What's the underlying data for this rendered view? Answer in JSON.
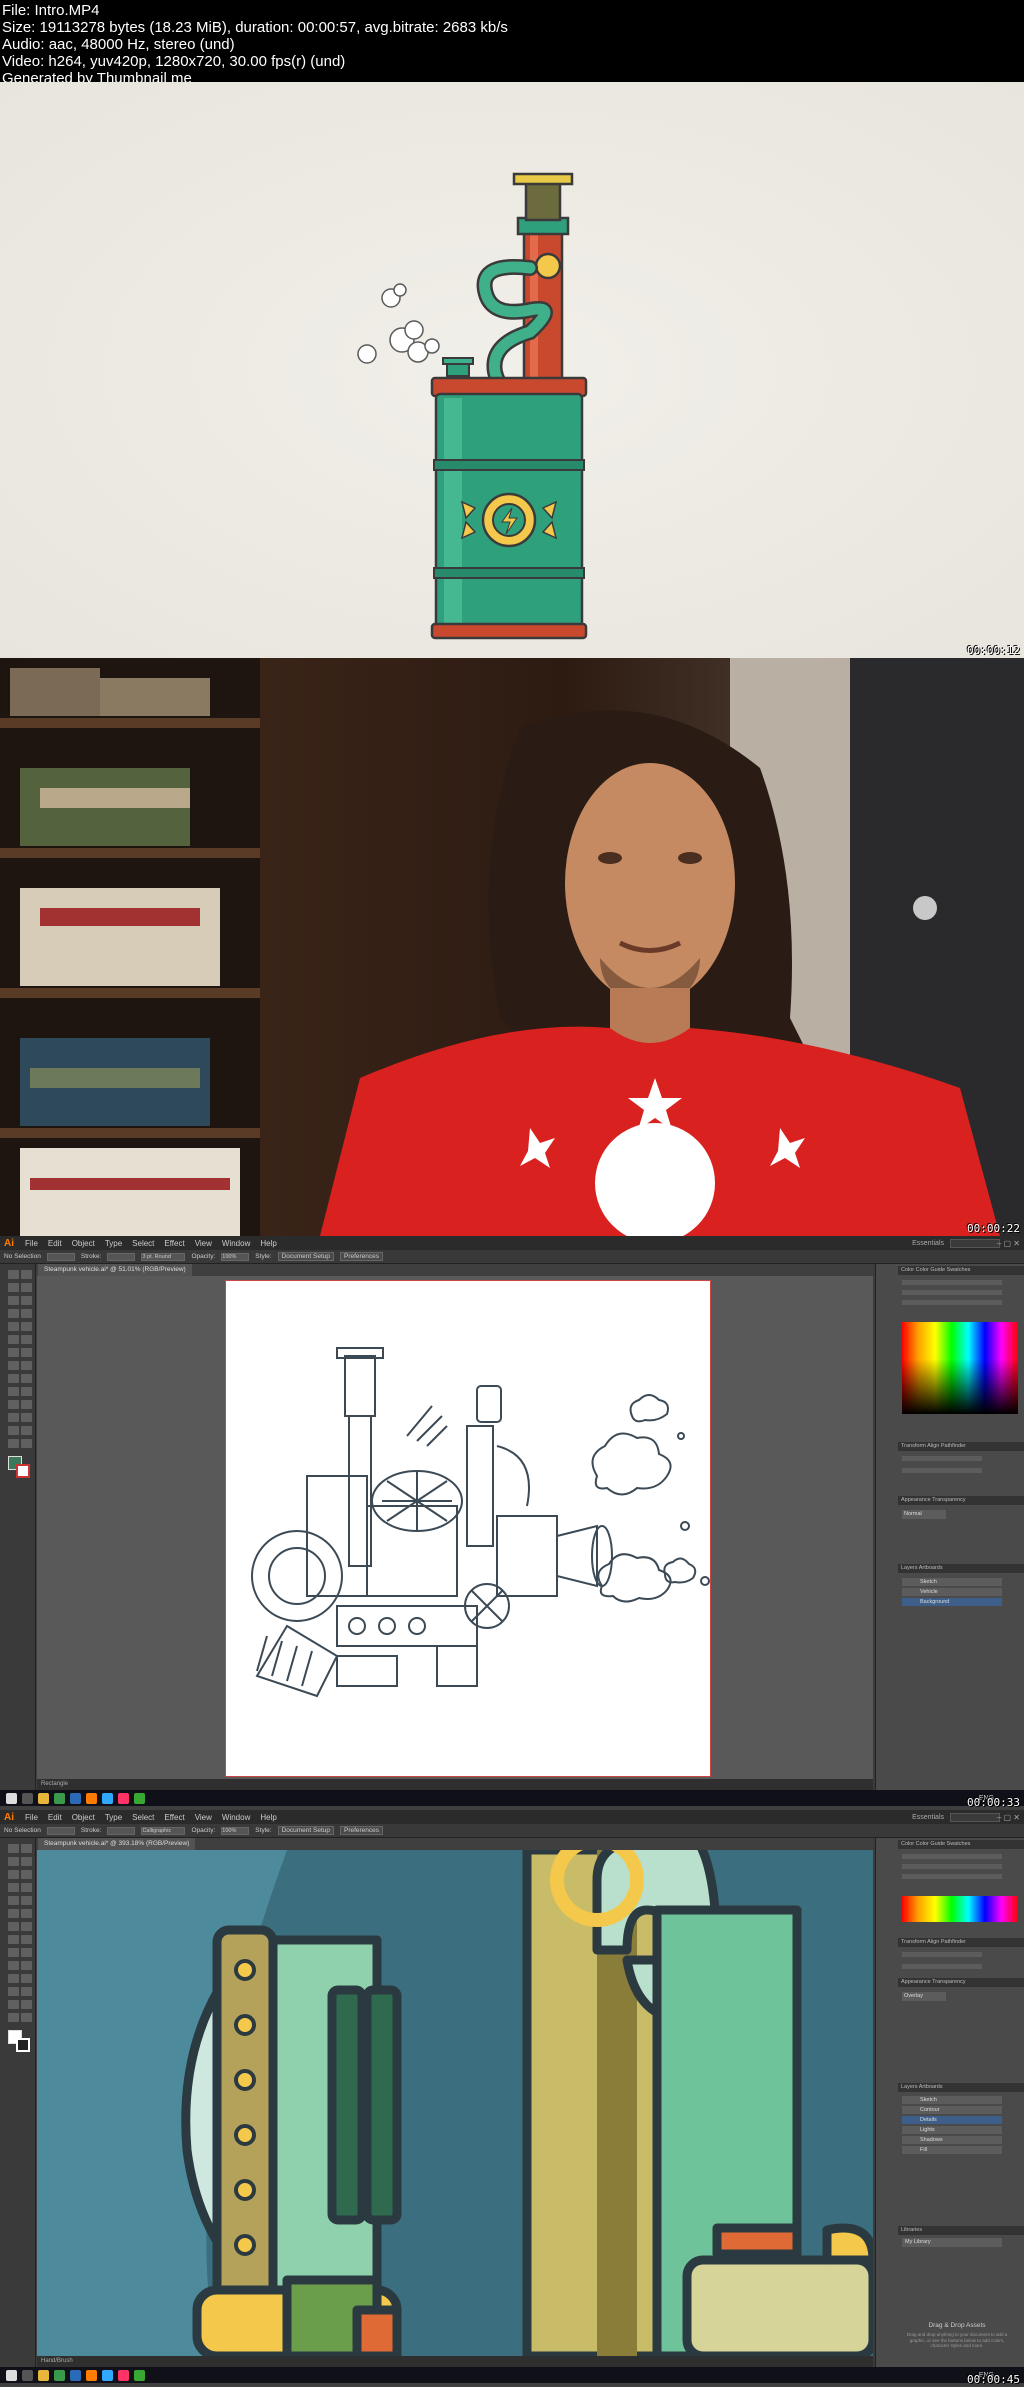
{
  "header": {
    "file": "File: Intro.MP4",
    "size": "Size: 19113278 bytes (18.23 MiB), duration: 00:00:57, avg.bitrate: 2683 kb/s",
    "audio": "Audio: aac, 48000 Hz, stereo (und)",
    "video": "Video: h264, yuv420p, 1280x720, 30.00 fps(r) (und)",
    "generator": "Generated by Thumbnail me"
  },
  "frames": [
    {
      "timestamp": "00:00:12"
    },
    {
      "timestamp": "00:00:22"
    },
    {
      "timestamp": "00:00:33"
    },
    {
      "timestamp": "00:00:45"
    }
  ],
  "illustrator": {
    "logo": "Ai",
    "menu": [
      "File",
      "Edit",
      "Object",
      "Type",
      "Select",
      "Effect",
      "View",
      "Window",
      "Help"
    ],
    "workspace": "Essentials",
    "control": {
      "selection": "No Selection",
      "stroke_label": "Stroke:",
      "opacity_label": "Opacity:",
      "opacity_value": "100%",
      "style_label": "Style:",
      "document_setup": "Document Setup",
      "preferences": "Preferences",
      "brush_f3": "3 pt. Round",
      "brush_f4": "Calligraphic"
    },
    "doc_tab_f3": "Steampunk vehicle.ai* @ 51.01% (RGB/Preview)",
    "doc_tab_f4": "Steampunk vehicle.ai* @ 393.18% (RGB/Preview)",
    "status_f3": "Rectangle",
    "status_f4": "Hand/Brush",
    "panel_tabs_top": "Color  Color Guide  Swatches",
    "panel_tabs_mid": "Transform  Align  Pathfinder",
    "panel_tabs_tr": "Appearance  Transparency",
    "panel_tabs_layers": "Layers  Artboards",
    "blend_mode": "Normal",
    "blend_mode_f4": "Overlay",
    "layers_f3": [
      "Sketch",
      "Vehicle",
      "Background"
    ],
    "layers_f4": [
      "Sketch",
      "Contour",
      "Details",
      "Lights",
      "Shadows",
      "Fill"
    ],
    "libraries_label": "Libraries",
    "library_name": "My Library",
    "drag_drop_title": "Drag & Drop Assets",
    "drag_drop_text": "Drag and drop anything to your document to add a graphic, or see the buttons below to add colors, character styles and more.",
    "tray_lang": "ENG"
  },
  "colors": {
    "frame1_bg": "#ece9e2",
    "barrel_green": "#2fa07c",
    "barrel_red": "#c9492f",
    "accent_yellow": "#f4c84a",
    "illustrator_ui": "#3f3f3f",
    "zoom_bg": "#4d8a9c"
  }
}
